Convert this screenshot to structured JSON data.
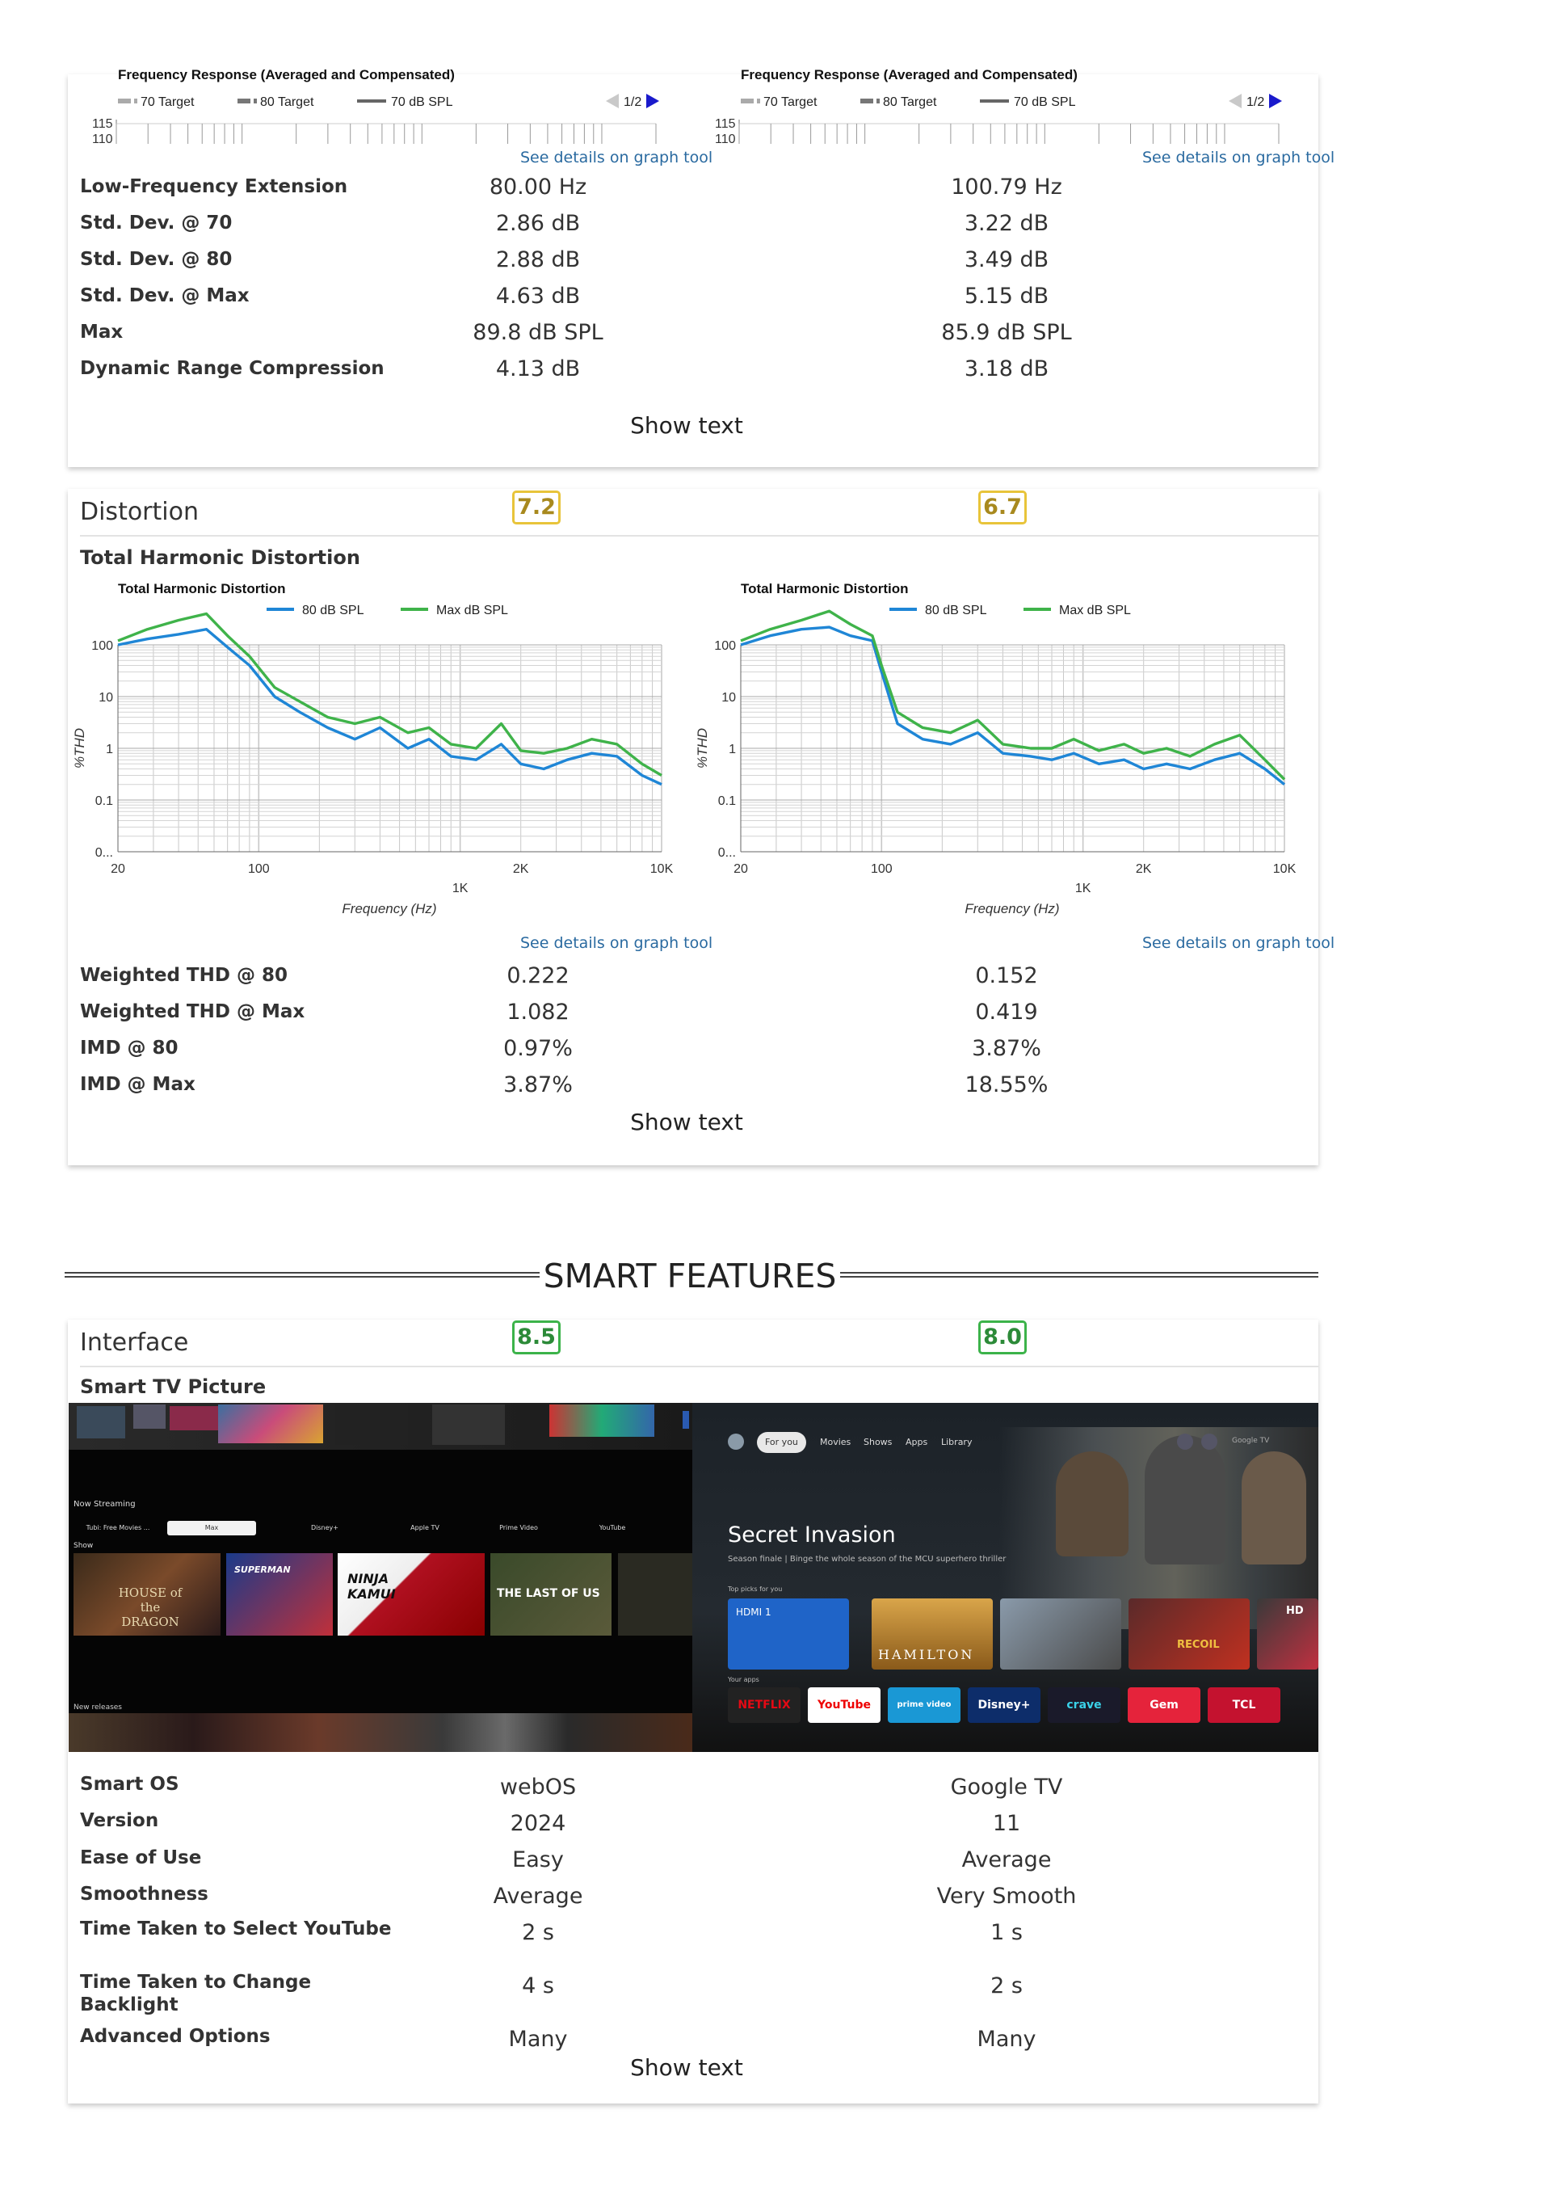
{
  "frequency_response": {
    "chart_title": "Frequency Response (Averaged and Compensated)",
    "legend": [
      "70 Target",
      "80 Target",
      "70 dB SPL"
    ],
    "pager": "1/2",
    "y_top_label": "115",
    "y_cut_label": "110",
    "graph_link": "See details on graph tool",
    "rows": [
      {
        "label": "Low-Frequency Extension",
        "v1": "80.00 Hz",
        "v2": "100.79 Hz"
      },
      {
        "label": "Std. Dev. @ 70",
        "v1": "2.86 dB",
        "v2": "3.22 dB"
      },
      {
        "label": "Std. Dev. @ 80",
        "v1": "2.88 dB",
        "v2": "3.49 dB"
      },
      {
        "label": "Std. Dev. @ Max",
        "v1": "4.63 dB",
        "v2": "5.15 dB"
      },
      {
        "label": "Max",
        "v1": "89.8 dB SPL",
        "v2": "85.9 dB SPL"
      },
      {
        "label": "Dynamic Range Compression",
        "v1": "4.13 dB",
        "v2": "3.18 dB"
      }
    ],
    "show_text": "Show text"
  },
  "distortion": {
    "title": "Distortion",
    "score1": "7.2",
    "score2": "6.7",
    "subtitle": "Total Harmonic Distortion",
    "graph_link": "See details on graph tool",
    "rows": [
      {
        "label": "Weighted THD @ 80",
        "v1": "0.222",
        "v2": "0.152"
      },
      {
        "label": "Weighted THD @ Max",
        "v1": "1.082",
        "v2": "0.419"
      },
      {
        "label": "IMD @ 80",
        "v1": "0.97%",
        "v2": "3.87%"
      },
      {
        "label": "IMD @ Max",
        "v1": "3.87%",
        "v2": "18.55%"
      }
    ],
    "show_text": "Show text"
  },
  "chart_data": [
    {
      "type": "line",
      "title": "Total Harmonic Distortion",
      "xlabel": "Frequency (Hz)",
      "ylabel": "%THD",
      "x_scale": "log",
      "y_scale": "log",
      "x_ticks": [
        "20",
        "100",
        "1K",
        "2K",
        "10K"
      ],
      "y_ticks": [
        "100",
        "10",
        "1",
        "0.1",
        "0..."
      ],
      "legend_position": "top",
      "grid": true,
      "series": [
        {
          "name": "80 dB SPL",
          "color": "#1f86d6",
          "x": [
            20,
            28,
            40,
            55,
            70,
            90,
            120,
            160,
            220,
            300,
            400,
            550,
            700,
            900,
            1200,
            1600,
            2000,
            2600,
            3400,
            4500,
            6000,
            8000,
            10000
          ],
          "y": [
            100,
            130,
            160,
            200,
            90,
            40,
            10,
            5,
            2.5,
            1.5,
            2.5,
            1.0,
            1.5,
            0.7,
            0.6,
            1.2,
            0.5,
            0.4,
            0.6,
            0.8,
            0.7,
            0.3,
            0.2
          ]
        },
        {
          "name": "Max dB SPL",
          "color": "#3fb34a",
          "x": [
            20,
            28,
            40,
            55,
            70,
            90,
            120,
            160,
            220,
            300,
            400,
            550,
            700,
            900,
            1200,
            1600,
            2000,
            2600,
            3400,
            4500,
            6000,
            8000,
            10000
          ],
          "y": [
            120,
            200,
            300,
            400,
            150,
            60,
            15,
            8,
            4,
            3,
            4,
            2,
            2.5,
            1.2,
            1.0,
            3.0,
            0.9,
            0.8,
            1.0,
            1.5,
            1.2,
            0.5,
            0.3
          ]
        }
      ]
    },
    {
      "type": "line",
      "title": "Total Harmonic Distortion",
      "xlabel": "Frequency (Hz)",
      "ylabel": "%THD",
      "x_scale": "log",
      "y_scale": "log",
      "x_ticks": [
        "20",
        "100",
        "1K",
        "2K",
        "10K"
      ],
      "y_ticks": [
        "100",
        "10",
        "1",
        "0.1",
        "0..."
      ],
      "legend_position": "top",
      "grid": true,
      "series": [
        {
          "name": "80 dB SPL",
          "color": "#1f86d6",
          "x": [
            20,
            28,
            40,
            55,
            70,
            90,
            100,
            120,
            160,
            220,
            300,
            400,
            550,
            700,
            900,
            1200,
            1600,
            2000,
            2600,
            3400,
            4500,
            6000,
            8000,
            10000
          ],
          "y": [
            100,
            150,
            200,
            220,
            150,
            120,
            30,
            3,
            1.5,
            1.2,
            2.0,
            0.8,
            0.7,
            0.6,
            0.8,
            0.5,
            0.6,
            0.4,
            0.5,
            0.4,
            0.6,
            0.8,
            0.4,
            0.2
          ]
        },
        {
          "name": "Max dB SPL",
          "color": "#3fb34a",
          "x": [
            20,
            28,
            40,
            55,
            70,
            90,
            100,
            120,
            160,
            220,
            300,
            400,
            550,
            700,
            900,
            1200,
            1600,
            2000,
            2600,
            3400,
            4500,
            6000,
            8000,
            10000
          ],
          "y": [
            120,
            200,
            300,
            450,
            250,
            150,
            40,
            5,
            2.5,
            2.0,
            3.5,
            1.2,
            1.0,
            1.0,
            1.5,
            0.9,
            1.2,
            0.8,
            1.0,
            0.7,
            1.2,
            1.8,
            0.6,
            0.25
          ]
        }
      ]
    }
  ],
  "smart_features": {
    "heading": "SMART FEATURES"
  },
  "interface": {
    "title": "Interface",
    "score1": "8.5",
    "score2": "8.0",
    "subtitle": "Smart TV Picture",
    "left_screen": {
      "row_label": "Now Streaming",
      "tabs": [
        "Tubi: Free Movies ...",
        "Max",
        "Disney+",
        "Apple TV",
        "Prime Video",
        "YouTube"
      ],
      "show_label": "Show",
      "tiles": [
        "HOUSE of the DRAGON",
        "SUPERMAN",
        "NINJA KAMUI",
        "THE LAST OF US"
      ],
      "new_label": "New releases"
    },
    "right_screen": {
      "nav": [
        "For you",
        "Movies",
        "Shows",
        "Apps",
        "Library"
      ],
      "brand": "Google TV",
      "hero_title": "Secret Invasion",
      "hero_sub": "Season finale | Binge the whole season of the MCU superhero thriller",
      "picks_label": "Top picks for you",
      "tiles": [
        "HDMI 1",
        "HAMILTON",
        "",
        "RECOIL",
        "HD"
      ],
      "apps_label": "Your apps",
      "apps": [
        "NETFLIX",
        "YouTube",
        "prime video",
        "Disney+",
        "crave",
        "Gem",
        "TCL"
      ]
    },
    "rows": [
      {
        "label": "Smart OS",
        "v1": "webOS",
        "v2": "Google TV"
      },
      {
        "label": "Version",
        "v1": "2024",
        "v2": "11"
      },
      {
        "label": "Ease of Use",
        "v1": "Easy",
        "v2": "Average"
      },
      {
        "label": "Smoothness",
        "v1": "Average",
        "v2": "Very Smooth"
      },
      {
        "label": "Time Taken to Select YouTube",
        "v1": "2 s",
        "v2": "1 s"
      },
      {
        "label": "Time Taken to Change Backlight",
        "v1": "4 s",
        "v2": "2 s"
      },
      {
        "label": "Advanced Options",
        "v1": "Many",
        "v2": "Many"
      }
    ],
    "show_text": "Show text"
  }
}
